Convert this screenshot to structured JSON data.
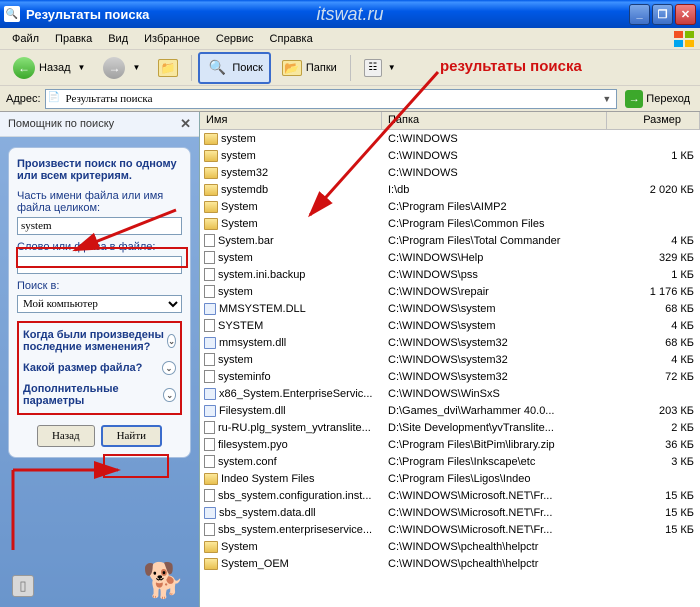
{
  "window": {
    "title": "Результаты поиска",
    "watermark": "itswat.ru"
  },
  "menu": {
    "file": "Файл",
    "edit": "Правка",
    "view": "Вид",
    "favorites": "Избранное",
    "tools": "Сервис",
    "help": "Справка"
  },
  "toolbar": {
    "back": "Назад",
    "search": "Поиск",
    "folders": "Папки"
  },
  "addressbar": {
    "label": "Адрес:",
    "value": "Результаты поиска",
    "go": "Переход"
  },
  "sidebar": {
    "title": "Помощник по поиску",
    "heading": "Произвести поиск по одному или всем критериям.",
    "filename_label": "Часть имени файла или имя файла целиком:",
    "filename_value": "system",
    "phrase_label": "Слово или фраза в файле:",
    "phrase_value": "",
    "lookin_label": "Поиск в:",
    "lookin_value": "Мой компьютер",
    "exp1": "Когда были произведены последние изменения?",
    "exp2": "Какой размер файла?",
    "exp3": "Дополнительные параметры",
    "back_btn": "Назад",
    "find_btn": "Найти"
  },
  "columns": {
    "name": "Имя",
    "path": "Папка",
    "size": "Размер"
  },
  "annotation_label": "результаты поиска",
  "results": [
    {
      "icon": "folder",
      "name": "system",
      "path": "C:\\WINDOWS",
      "size": ""
    },
    {
      "icon": "folder",
      "name": "system",
      "path": "C:\\WINDOWS",
      "size": "1 КБ"
    },
    {
      "icon": "folder",
      "name": "system32",
      "path": "C:\\WINDOWS",
      "size": ""
    },
    {
      "icon": "folder",
      "name": "systemdb",
      "path": "I:\\db",
      "size": "2 020 КБ"
    },
    {
      "icon": "folder",
      "name": "System",
      "path": "C:\\Program Files\\AIMP2",
      "size": ""
    },
    {
      "icon": "folder",
      "name": "System",
      "path": "C:\\Program Files\\Common Files",
      "size": ""
    },
    {
      "icon": "file",
      "name": "System.bar",
      "path": "C:\\Program Files\\Total Commander",
      "size": "4 КБ"
    },
    {
      "icon": "file",
      "name": "system",
      "path": "C:\\WINDOWS\\Help",
      "size": "329 КБ"
    },
    {
      "icon": "file",
      "name": "system.ini.backup",
      "path": "C:\\WINDOWS\\pss",
      "size": "1 КБ"
    },
    {
      "icon": "file",
      "name": "system",
      "path": "C:\\WINDOWS\\repair",
      "size": "1 176 КБ"
    },
    {
      "icon": "dll",
      "name": "MMSYSTEM.DLL",
      "path": "C:\\WINDOWS\\system",
      "size": "68 КБ"
    },
    {
      "icon": "file",
      "name": "SYSTEM",
      "path": "C:\\WINDOWS\\system",
      "size": "4 КБ"
    },
    {
      "icon": "dll",
      "name": "mmsystem.dll",
      "path": "C:\\WINDOWS\\system32",
      "size": "68 КБ"
    },
    {
      "icon": "file",
      "name": "system",
      "path": "C:\\WINDOWS\\system32",
      "size": "4 КБ"
    },
    {
      "icon": "file",
      "name": "systeminfo",
      "path": "C:\\WINDOWS\\system32",
      "size": "72 КБ"
    },
    {
      "icon": "dll",
      "name": "x86_System.EnterpriseServic...",
      "path": "C:\\WINDOWS\\WinSxS",
      "size": ""
    },
    {
      "icon": "dll",
      "name": "Filesystem.dll",
      "path": "D:\\Games_dvi\\Warhammer 40.0...",
      "size": "203 КБ"
    },
    {
      "icon": "file",
      "name": "ru-RU.plg_system_yvtranslite...",
      "path": "D:\\Site Development\\yvTranslite...",
      "size": "2 КБ"
    },
    {
      "icon": "file",
      "name": "filesystem.pyo",
      "path": "C:\\Program Files\\BitPim\\library.zip",
      "size": "36 КБ"
    },
    {
      "icon": "file",
      "name": "system.conf",
      "path": "C:\\Program Files\\Inkscape\\etc",
      "size": "3 КБ"
    },
    {
      "icon": "folder",
      "name": "Indeo System Files",
      "path": "C:\\Program Files\\Ligos\\Indeo",
      "size": ""
    },
    {
      "icon": "file",
      "name": "sbs_system.configuration.inst...",
      "path": "C:\\WINDOWS\\Microsoft.NET\\Fr...",
      "size": "15 КБ"
    },
    {
      "icon": "dll",
      "name": "sbs_system.data.dll",
      "path": "C:\\WINDOWS\\Microsoft.NET\\Fr...",
      "size": "15 КБ"
    },
    {
      "icon": "file",
      "name": "sbs_system.enterpriseservice...",
      "path": "C:\\WINDOWS\\Microsoft.NET\\Fr...",
      "size": "15 КБ"
    },
    {
      "icon": "folder",
      "name": "System",
      "path": "C:\\WINDOWS\\pchealth\\helpctr",
      "size": ""
    },
    {
      "icon": "folder",
      "name": "System_OEM",
      "path": "C:\\WINDOWS\\pchealth\\helpctr",
      "size": ""
    }
  ]
}
